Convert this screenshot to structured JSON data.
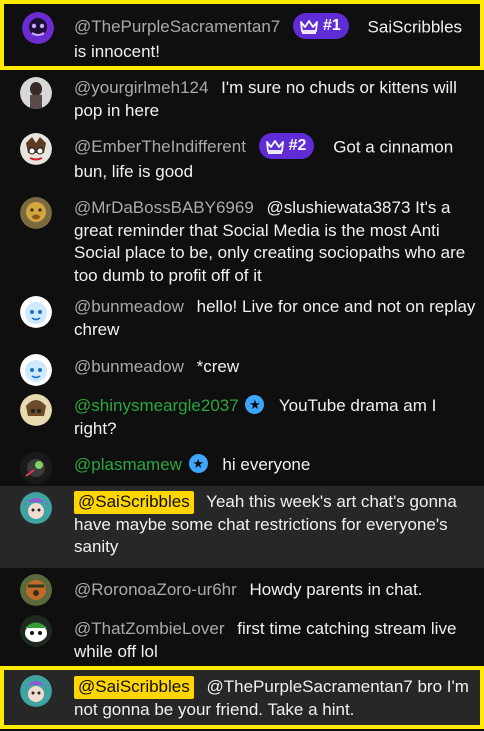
{
  "messages": [
    {
      "author": "@ThePurpleSacramentan7",
      "badge": "#1",
      "text": "SaiScribbles is innocent!"
    },
    {
      "author": "@yourgirlmeh124",
      "text": "I'm sure no chuds or kittens will pop in here"
    },
    {
      "author": "@EmberTheIndifferent",
      "badge": "#2",
      "text": "Got a cinnamon bun, life is good"
    },
    {
      "author": "@MrDaBossBABY6969",
      "text": "@slushiewata3873 It's a great reminder that Social Media is the most Anti Social place to be, only creating sociopaths who are too dumb to profit off of it"
    },
    {
      "author": "@bunmeadow",
      "text": "hello! Live for once and not on replay chrew"
    },
    {
      "author": "@bunmeadow",
      "text": "*crew"
    },
    {
      "author": "@shinysmeargle2037",
      "text": "YouTube drama am I right?"
    },
    {
      "author": "@plasmamew",
      "text": "hi everyone"
    },
    {
      "author": "@SaiScribbles",
      "text": "Yeah this week's art chat's gonna have maybe some chat restrictions for everyone's sanity"
    },
    {
      "author": "@RoronoaZoro-ur6hr",
      "text": "Howdy parents in chat."
    },
    {
      "author": "@ThatZombieLover",
      "text": "first time catching stream live while off lol"
    },
    {
      "author": "@SaiScribbles",
      "text": "@ThePurpleSacramentan7 bro I'm not gonna be your friend. Take a hint."
    }
  ],
  "colors": {
    "highlight_border": "#ffeb00",
    "owner_chip": "#ffd600",
    "crown_badge": "#5f2cd6",
    "member_name": "#2ba640",
    "verified": "#3ea6ff"
  }
}
